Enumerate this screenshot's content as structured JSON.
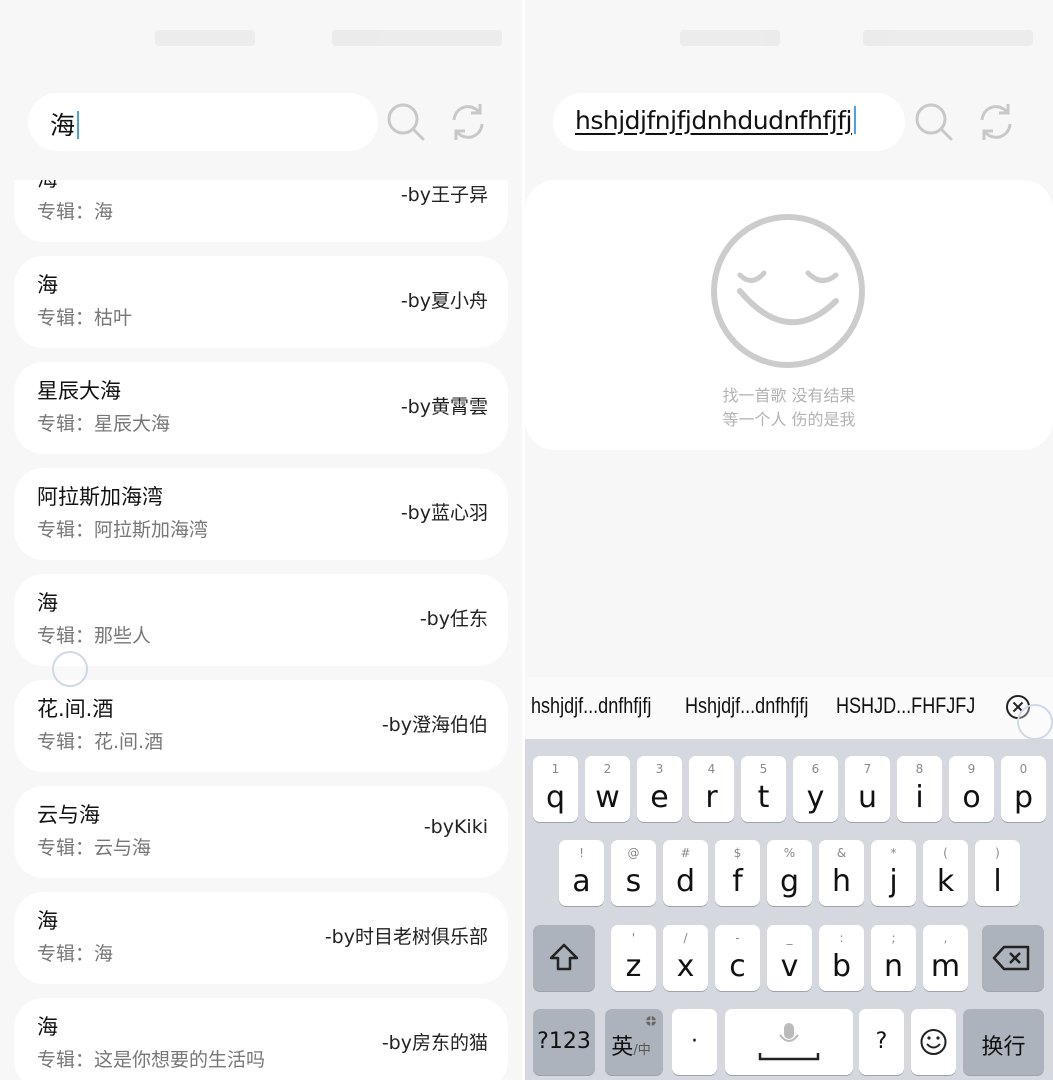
{
  "left_panel": {
    "search": {
      "value": "海"
    },
    "results": [
      {
        "title": "海",
        "album": "专辑：海",
        "artist": "-by王子异"
      },
      {
        "title": "海",
        "album": "专辑：枯叶",
        "artist": "-by夏小舟"
      },
      {
        "title": "星辰大海",
        "album": "专辑：星辰大海",
        "artist": "-by黄霄雲"
      },
      {
        "title": "阿拉斯加海湾",
        "album": "专辑：阿拉斯加海湾",
        "artist": "-by蓝心羽"
      },
      {
        "title": "海",
        "album": "专辑：那些人",
        "artist": "-by任东"
      },
      {
        "title": "花.间.酒",
        "album": "专辑：花.间.酒",
        "artist": "-by澄海伯伯"
      },
      {
        "title": "云与海",
        "album": "专辑：云与海",
        "artist": "-byKiki"
      },
      {
        "title": "海",
        "album": "专辑：海",
        "artist": "-by时目老树俱乐部"
      },
      {
        "title": "海",
        "album": "专辑：这是你想要的生活吗",
        "artist": "-by房东的猫"
      }
    ]
  },
  "right_panel": {
    "search": {
      "value": "hshjdjfnjfjdnhdudnfhfjfj"
    },
    "empty_state": {
      "line1": "找一首歌 没有结果",
      "line2": "等一个人 伤的是我"
    },
    "suggestions": [
      "hshjdjf...dnfhfjfj",
      "Hshjdjf...dnfhfjfj",
      "HSHJD...FHFJFJ"
    ],
    "keyboard": {
      "row1": [
        {
          "hint": "1",
          "key": "q"
        },
        {
          "hint": "2",
          "key": "w"
        },
        {
          "hint": "3",
          "key": "e"
        },
        {
          "hint": "4",
          "key": "r"
        },
        {
          "hint": "5",
          "key": "t"
        },
        {
          "hint": "6",
          "key": "y"
        },
        {
          "hint": "7",
          "key": "u"
        },
        {
          "hint": "8",
          "key": "i"
        },
        {
          "hint": "9",
          "key": "o"
        },
        {
          "hint": "0",
          "key": "p"
        }
      ],
      "row2": [
        {
          "hint": "!",
          "key": "a"
        },
        {
          "hint": "@",
          "key": "s"
        },
        {
          "hint": "#",
          "key": "d"
        },
        {
          "hint": "$",
          "key": "f"
        },
        {
          "hint": "%",
          "key": "g"
        },
        {
          "hint": "&",
          "key": "h"
        },
        {
          "hint": "*",
          "key": "j"
        },
        {
          "hint": "(",
          "key": "k"
        },
        {
          "hint": ")",
          "key": "l"
        }
      ],
      "row3": [
        {
          "hint": "'",
          "key": "z"
        },
        {
          "hint": "/",
          "key": "x"
        },
        {
          "hint": "-",
          "key": "c"
        },
        {
          "hint": "_",
          "key": "v"
        },
        {
          "hint": ":",
          "key": "b"
        },
        {
          "hint": ";",
          "key": "n"
        },
        {
          "hint": ",",
          "key": "m"
        }
      ],
      "num_label": "?123",
      "lang_label_main": "英",
      "lang_label_sub": "/中",
      "dot_label": "·",
      "question_label": "?",
      "enter_label": "换行"
    }
  },
  "colors": {
    "background": "#f7f7f7",
    "card": "#ffffff",
    "keyboard_bg": "#d5d8de",
    "caret": "#4aa3df",
    "muted_text": "#b3b3b3"
  }
}
